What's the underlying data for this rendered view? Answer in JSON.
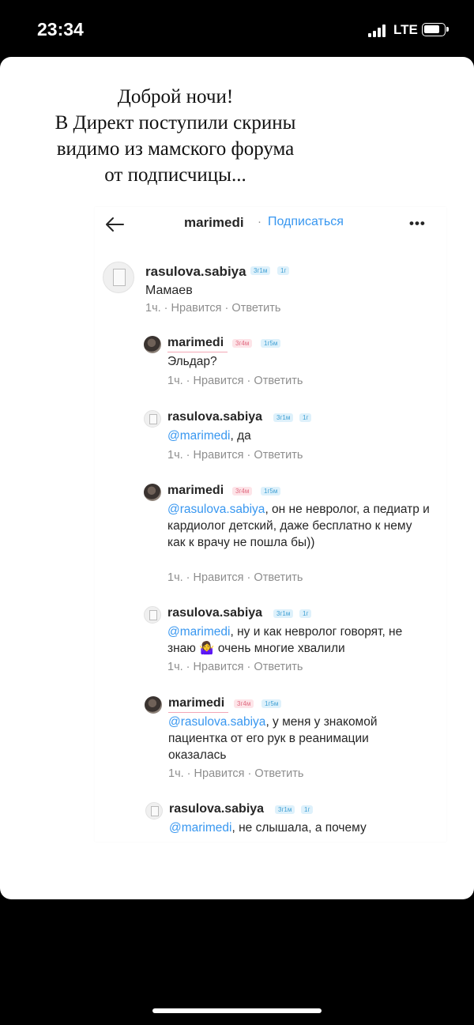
{
  "status_bar": {
    "time": "23:34",
    "network": "LTE"
  },
  "caption": {
    "lines": [
      "Доброй ночи!",
      "В Директ поступили скрины",
      "видимо из мамского форума",
      "от подписчицы..."
    ]
  },
  "post_header": {
    "username": "marimedi",
    "separator": "·",
    "follow_label": "Подписаться",
    "more_label": "•••"
  },
  "comments": [
    {
      "username": "rasulova.sabiya",
      "badge1": "3г1м",
      "badge2": "1г",
      "mention": "",
      "text": "Мамаев",
      "time": "1ч.",
      "like": "Нравится",
      "reply": "Ответить"
    },
    {
      "username": "marimedi",
      "badge1": "3г4м",
      "badge2": "1г5м",
      "mention": "",
      "text": "Эльдар?",
      "time": "1ч.",
      "like": "Нравится",
      "reply": "Ответить"
    },
    {
      "username": "rasulova.sabiya",
      "badge1": "3г1м",
      "badge2": "1г",
      "mention": "@marimedi",
      "text": ", да",
      "time": "1ч.",
      "like": "Нравится",
      "reply": "Ответить"
    },
    {
      "username": "marimedi",
      "badge1": "3г4м",
      "badge2": "1г5м",
      "mention": "@rasulova.sabiya",
      "text": ", он не невролог, а педиатр и кардиолог детский, даже бесплатно к нему как к врачу не пошла бы))",
      "time": "1ч.",
      "like": "Нравится",
      "reply": "Ответить"
    },
    {
      "username": "rasulova.sabiya",
      "badge1": "3г1м",
      "badge2": "1г",
      "mention": "@marimedi",
      "text": ", ну и как невролог говорят, не знаю 🤷‍♀️ очень многие хвалили",
      "time": "1ч.",
      "like": "Нравится",
      "reply": "Ответить"
    },
    {
      "username": "marimedi",
      "badge1": "3г4м",
      "badge2": "1г5м",
      "mention": "@rasulova.sabiya",
      "text": ", у меня у знакомой пациентка от его рук в реанимации оказалась",
      "time": "1ч.",
      "like": "Нравится",
      "reply": "Ответить"
    },
    {
      "username": "rasulova.sabiya",
      "badge1": "3г1м",
      "badge2": "1г",
      "mention": "@marimedi",
      "text": ", не слышала, а почему",
      "time": "",
      "like": "",
      "reply": ""
    }
  ],
  "icons": {
    "back": "arrow-left-icon",
    "more": "more-dots-icon",
    "avatar_doc": "document-avatar",
    "avatar_photo": "photo-avatar"
  }
}
